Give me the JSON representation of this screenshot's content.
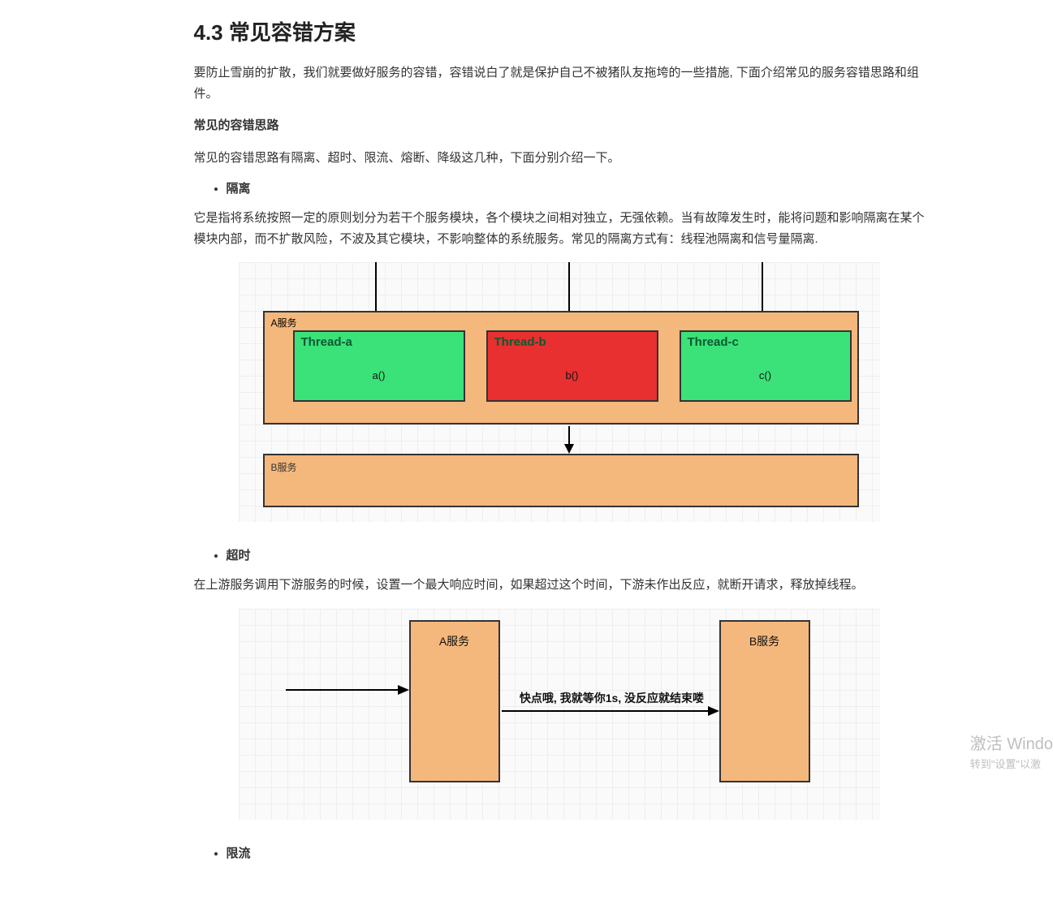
{
  "heading": "4.3 常见容错方案",
  "intro": "要防止雪崩的扩散，我们就要做好服务的容错，容错说白了就是保护自己不被猪队友拖垮的一些措施, 下面介绍常见的服务容错思路和组件。",
  "sub1": "常见的容错思路",
  "sub1_p": "常见的容错思路有隔离、超时、限流、熔断、降级这几种，下面分别介绍一下。",
  "li1": "隔离",
  "iso_p": "它是指将系统按照一定的原则划分为若干个服务模块，各个模块之间相对独立，无强依赖。当有故障发生时，能将问题和影响隔离在某个模块内部，而不扩散风险，不波及其它模块，不影响整体的系统服务。常见的隔离方式有：线程池隔离和信号量隔离.",
  "diagram1": {
    "a_label": "A服务",
    "b_label": "B服务",
    "threads": {
      "a": {
        "title": "Thread-a",
        "call": "a()"
      },
      "b": {
        "title": "Thread-b",
        "call": "b()"
      },
      "c": {
        "title": "Thread-c",
        "call": "c()"
      }
    }
  },
  "li2": "超时",
  "timeout_p": "在上游服务调用下游服务的时候，设置一个最大响应时间，如果超过这个时间，下游未作出反应，就断开请求，释放掉线程。",
  "diagram2": {
    "a": "A服务",
    "b": "B服务",
    "msg": "快点哦, 我就等你1s, 没反应就结束喽"
  },
  "li3": "限流",
  "watermark": {
    "line1": "激活 Windo",
    "line2": "转到\"设置\"以激"
  }
}
